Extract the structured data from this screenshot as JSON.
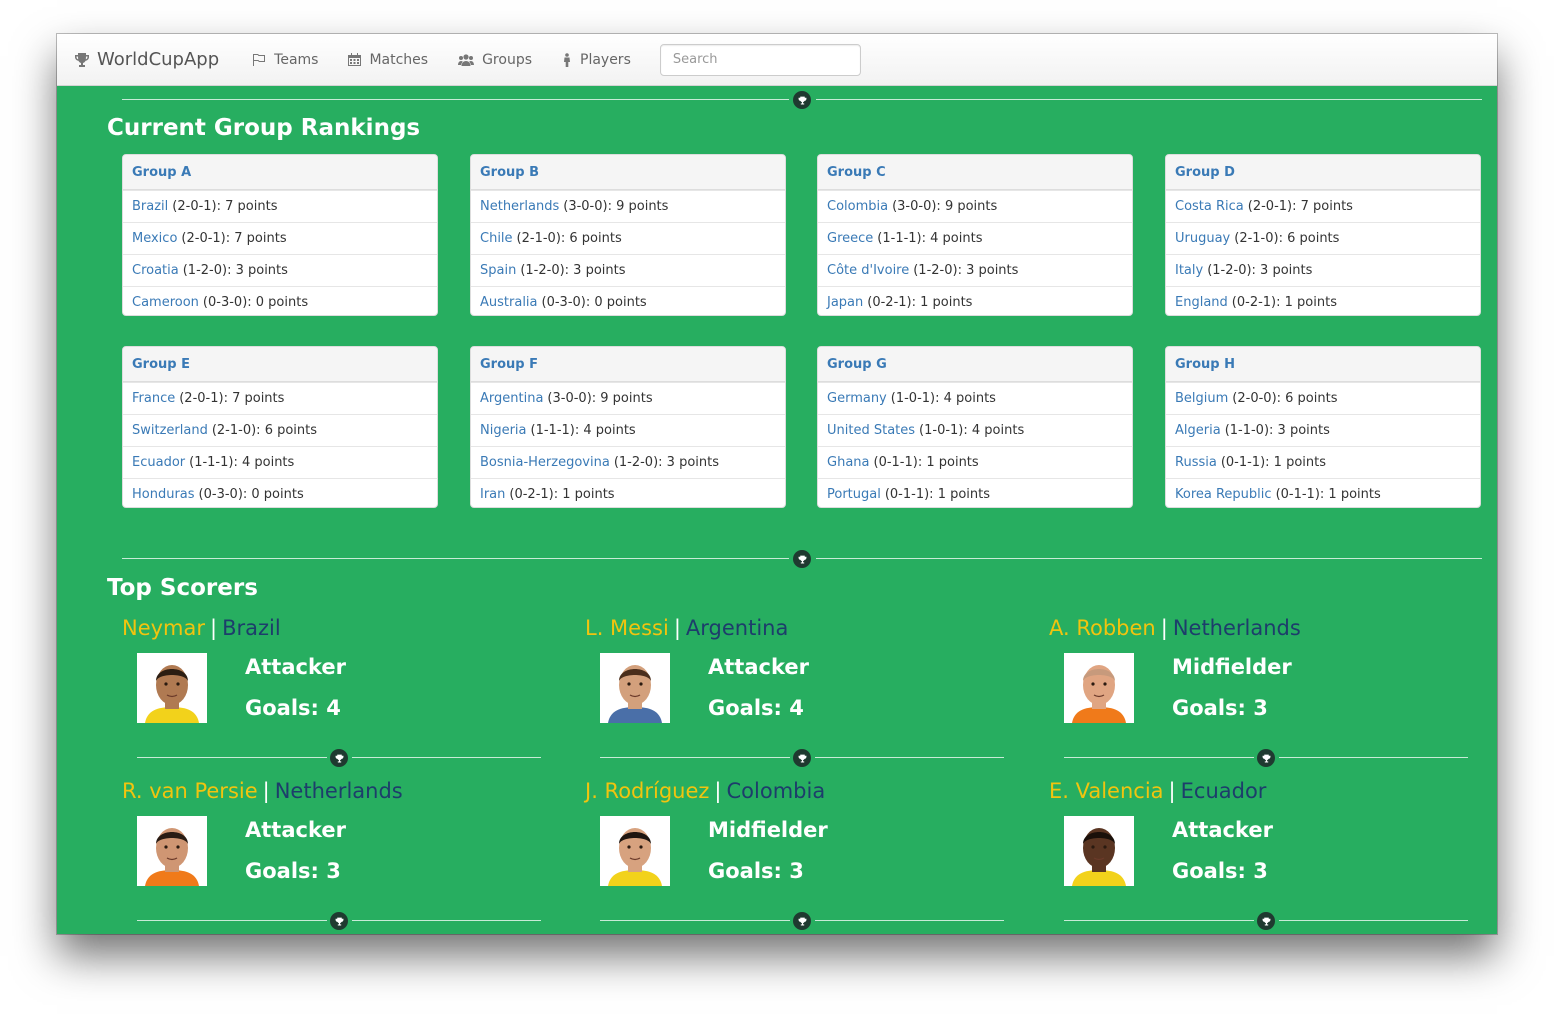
{
  "navbar": {
    "brand": "WorldCupApp",
    "items": [
      {
        "label": "Teams",
        "icon": "flag-icon"
      },
      {
        "label": "Matches",
        "icon": "calendar-icon"
      },
      {
        "label": "Groups",
        "icon": "users-icon"
      },
      {
        "label": "Players",
        "icon": "player-icon"
      }
    ],
    "search_placeholder": "Search"
  },
  "rankings": {
    "title": "Current Group Rankings",
    "groups": [
      {
        "name": "Group A",
        "teams": [
          {
            "team": "Brazil",
            "stats": "(2-0-1): 7 points"
          },
          {
            "team": "Mexico",
            "stats": "(2-0-1): 7 points"
          },
          {
            "team": "Croatia",
            "stats": "(1-2-0): 3 points"
          },
          {
            "team": "Cameroon",
            "stats": "(0-3-0): 0 points"
          }
        ]
      },
      {
        "name": "Group B",
        "teams": [
          {
            "team": "Netherlands",
            "stats": "(3-0-0): 9 points"
          },
          {
            "team": "Chile",
            "stats": "(2-1-0): 6 points"
          },
          {
            "team": "Spain",
            "stats": "(1-2-0): 3 points"
          },
          {
            "team": "Australia",
            "stats": "(0-3-0): 0 points"
          }
        ]
      },
      {
        "name": "Group C",
        "teams": [
          {
            "team": "Colombia",
            "stats": "(3-0-0): 9 points"
          },
          {
            "team": "Greece",
            "stats": "(1-1-1): 4 points"
          },
          {
            "team": "Côte d'Ivoire",
            "stats": "(1-2-0): 3 points"
          },
          {
            "team": "Japan",
            "stats": "(0-2-1): 1 points"
          }
        ]
      },
      {
        "name": "Group D",
        "teams": [
          {
            "team": "Costa Rica",
            "stats": "(2-0-1): 7 points"
          },
          {
            "team": "Uruguay",
            "stats": "(2-1-0): 6 points"
          },
          {
            "team": "Italy",
            "stats": "(1-2-0): 3 points"
          },
          {
            "team": "England",
            "stats": "(0-2-1): 1 points"
          }
        ]
      },
      {
        "name": "Group E",
        "teams": [
          {
            "team": "France",
            "stats": "(2-0-1): 7 points"
          },
          {
            "team": "Switzerland",
            "stats": "(2-1-0): 6 points"
          },
          {
            "team": "Ecuador",
            "stats": "(1-1-1): 4 points"
          },
          {
            "team": "Honduras",
            "stats": "(0-3-0): 0 points"
          }
        ]
      },
      {
        "name": "Group F",
        "teams": [
          {
            "team": "Argentina",
            "stats": "(3-0-0): 9 points"
          },
          {
            "team": "Nigeria",
            "stats": "(1-1-1): 4 points"
          },
          {
            "team": "Bosnia-Herzegovina",
            "stats": "(1-2-0): 3 points"
          },
          {
            "team": "Iran",
            "stats": "(0-2-1): 1 points"
          }
        ]
      },
      {
        "name": "Group G",
        "teams": [
          {
            "team": "Germany",
            "stats": "(1-0-1): 4 points"
          },
          {
            "team": "United States",
            "stats": "(1-0-1): 4 points"
          },
          {
            "team": "Ghana",
            "stats": "(0-1-1): 1 points"
          },
          {
            "team": "Portugal",
            "stats": "(0-1-1): 1 points"
          }
        ]
      },
      {
        "name": "Group H",
        "teams": [
          {
            "team": "Belgium",
            "stats": "(2-0-0): 6 points"
          },
          {
            "team": "Algeria",
            "stats": "(1-1-0): 3 points"
          },
          {
            "team": "Russia",
            "stats": "(0-1-1): 1 points"
          },
          {
            "team": "Korea Republic",
            "stats": "(0-1-1): 1 points"
          }
        ]
      }
    ]
  },
  "scorers": {
    "title": "Top Scorers",
    "players": [
      {
        "name": "Neymar",
        "country": "Brazil",
        "role": "Attacker",
        "goals": "Goals: 4",
        "skin": "#b07a52",
        "hair": "#2b1d12",
        "shirt": "#f2d21b"
      },
      {
        "name": "L. Messi",
        "country": "Argentina",
        "role": "Attacker",
        "goals": "Goals: 4",
        "skin": "#d3a07c",
        "hair": "#4a2e1c",
        "shirt": "#4a6fa8"
      },
      {
        "name": "A. Robben",
        "country": "Netherlands",
        "role": "Midfielder",
        "goals": "Goals: 3",
        "skin": "#e0a582",
        "hair": "#c79a7c",
        "shirt": "#f07a1a"
      },
      {
        "name": "R. van Persie",
        "country": "Netherlands",
        "role": "Attacker",
        "goals": "Goals: 3",
        "skin": "#cf9673",
        "hair": "#2a1c14",
        "shirt": "#f07a1a"
      },
      {
        "name": "J. Rodríguez",
        "country": "Colombia",
        "role": "Midfielder",
        "goals": "Goals: 3",
        "skin": "#d7a27f",
        "hair": "#1e1510",
        "shirt": "#f2d21b"
      },
      {
        "name": "E. Valencia",
        "country": "Ecuador",
        "role": "Attacker",
        "goals": "Goals: 3",
        "skin": "#5a3522",
        "hair": "#1a100a",
        "shirt": "#f2d21b"
      }
    ]
  }
}
